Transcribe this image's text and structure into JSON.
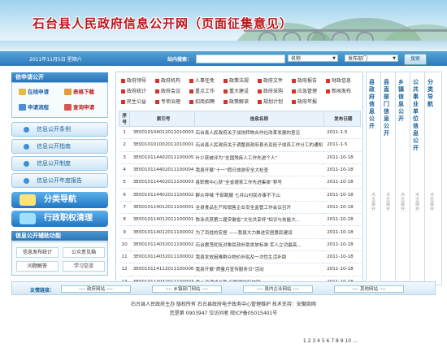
{
  "banner": {
    "title": "石台县人民政府信息公开网（页面征集意见）"
  },
  "topbar": {
    "date": "2011年11月5日 星期六",
    "search_label": "站内搜索：",
    "name_select": "名称",
    "dept_select": "发布部门",
    "search_button": "搜索"
  },
  "sidebar": {
    "apply_title": "依申请公开",
    "apply_buttons": [
      "在线申请",
      "表格下载",
      "申请流程",
      "查询申请"
    ],
    "menu": [
      "信息公开条例",
      "信息公开指南",
      "信息公开制度",
      "信息公开年度报告"
    ],
    "big_buttons": [
      "分类导航",
      "行政职权清理"
    ],
    "tools_title": "信息公开辅助功能",
    "tools": [
      "信息发布统计",
      "公众意见箱",
      "问题解答",
      "学习交流"
    ]
  },
  "categories": [
    [
      "政府领导",
      "政府机构",
      "人事任免",
      "政策法规",
      "政府文件",
      "政府报告",
      "财政信息"
    ],
    [
      "政府统计",
      "政府会议",
      "重点工作",
      "重大建设",
      "政府采购",
      "应急管理",
      "新闻发布"
    ],
    [
      "民生公益",
      "专项治理",
      "招商招聘",
      "政策解读",
      "规划计划",
      "政府年报"
    ]
  ],
  "table": {
    "headers": [
      "序号",
      "索引号",
      "信息名称",
      "发布日期"
    ],
    "rows": [
      [
        "1",
        "3E0010104012011010003",
        "石台县人民政府关于加快转物合作社改革发展的意见",
        "2011-1-5"
      ],
      [
        "2",
        "3E0010101002011010001",
        "石台县人民政府关于调整县政府县长及班子成员工作分工的通知",
        "2011-1-5"
      ],
      [
        "3",
        "3E0010114402011100005",
        "叶少获被评为“全国残疾人工作先进个人”",
        "2011-10-18"
      ],
      [
        "4",
        "3E0010114402011100004",
        "我县开展“十一”假日旅游安全大检查",
        "2011-10-18"
      ],
      [
        "5",
        "3E0010114402011100003",
        "县职教中心获“全省德育工作先进集体”称号",
        "2011-10-18"
      ],
      [
        "6",
        "3E0010114402011100002",
        "群众呼喊 干部跑腿 七井山村民办事不下山",
        "2011-10-18"
      ],
      [
        "7",
        "3E0010114012011100001",
        "全县食品生产和销售企业安全监管工作会议召开",
        "2011-10-18"
      ],
      [
        "8",
        "3E0010114012011100001",
        "陈涂兵获第二届安徽省“文化共享杯”知识与技能大…",
        "2011-10-18"
      ],
      [
        "9",
        "3E0010114012011100002",
        "为了百姓的安居 ——我县大力推进安居惠民建设",
        "2011-10-18"
      ],
      [
        "10",
        "3E0010114032011100002",
        "石台震荡优抚对象民政补助发放标准 军人立功最高…",
        "2011-10-18"
      ],
      [
        "11",
        "3E0010114032011100002",
        "我县发放困难群众物价补贴及一次性生活补助",
        "2011-10-18"
      ],
      [
        "12",
        "3E0010114112011100006",
        "我县开展“质量月宣传服务日”活动",
        "2011-10-18"
      ],
      [
        "13",
        "3E0010114042011100003",
        "爱心浇灌成长路 红歌唱响新校园",
        "2011-10-18"
      ]
    ],
    "pager": "1 2 3 4 5 6 7 8 9 10 …"
  },
  "right_columns": [
    {
      "title": "县政府信息公开",
      "more": "点击展开"
    },
    {
      "title": "县直部门信息公开",
      "more": "点击展开"
    },
    {
      "title": "乡镇信息公开",
      "more": "点击展开"
    },
    {
      "title": "公共事业单位信息公开",
      "more": "点击展开"
    },
    {
      "title": "分类导航",
      "more": "点击展开"
    }
  ],
  "links": {
    "label": "友情链接：",
    "selects": [
      "---- 政府网站 ----",
      "---- 乡镇部门网站 ----",
      "---- 县内企业网站 ----",
      "---- 其他网站 ----"
    ]
  },
  "footer": {
    "line1": "石台县人民政府主办  版权所有    石台县政府电子政务中心管理维护    技术支持：安徽商网",
    "line2": "您是第 0903947 位访问者  皖ICP备05015401号"
  }
}
